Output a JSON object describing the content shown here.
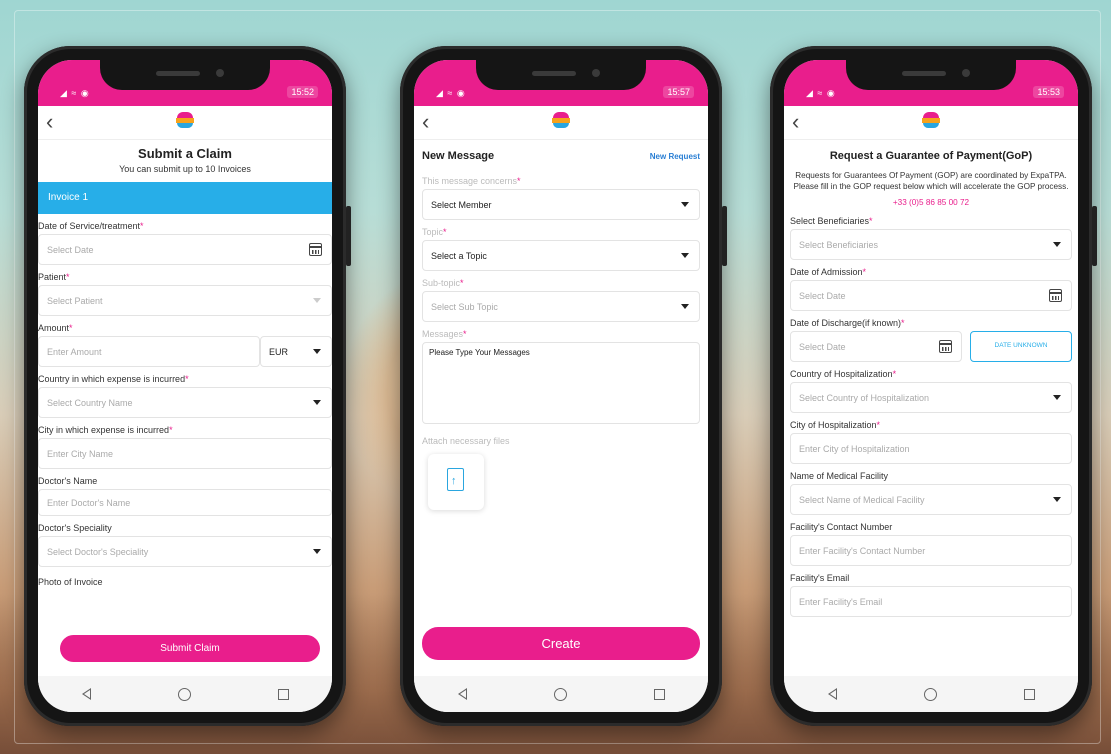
{
  "status": {
    "signal": "◢ ≈ ◉"
  },
  "claim": {
    "time": "15:52",
    "title": "Submit a Claim",
    "subtitle": "You can submit up to 10 Invoices",
    "invoice_label": "Invoice 1",
    "fields": {
      "service_date": {
        "label": "Date of Service/treatment",
        "placeholder": "Select Date"
      },
      "patient": {
        "label": "Patient",
        "placeholder": "Select Patient"
      },
      "amount": {
        "label": "Amount",
        "placeholder": "Enter Amount",
        "currency": "EUR"
      },
      "country": {
        "label": "Country in which expense is incurred",
        "placeholder": "Select Country Name"
      },
      "city": {
        "label": "City in which expense is incurred",
        "placeholder": "Enter City Name"
      },
      "doctor_name": {
        "label": "Doctor's Name",
        "placeholder": "Enter Doctor's Name"
      },
      "doctor_speciality": {
        "label": "Doctor's Speciality",
        "placeholder": "Select Doctor's Speciality"
      },
      "photo": {
        "label": "Photo of Invoice"
      }
    },
    "submit_label": "Submit Claim"
  },
  "message": {
    "time": "15:57",
    "title": "New Message",
    "new_request": "New Request",
    "concerns": {
      "label": "This message concerns",
      "value": "Select Member"
    },
    "topic": {
      "label": "Topic",
      "value": "Select a Topic"
    },
    "subtopic": {
      "label": "Sub-topic",
      "placeholder": "Select Sub Topic"
    },
    "messages": {
      "label": "Messages",
      "placeholder": "Please Type Your Messages"
    },
    "attach_label": "Attach necessary files",
    "create_label": "Create"
  },
  "gop": {
    "time": "15:53",
    "title": "Request a Guarantee of Payment(GoP)",
    "description": "Requests for Guarantees Of Payment (GOP) are coordinated by ExpaTPA. Please fill in the GOP request below which will accelerate the GOP process.",
    "phone": "+33 (0)5 86 85 00 72",
    "beneficiaries": {
      "label": "Select Beneficiaries",
      "placeholder": "Select Beneficiaries"
    },
    "admission": {
      "label": "Date of Admission",
      "placeholder": "Select Date"
    },
    "discharge": {
      "label": "Date of Discharge(if known)",
      "placeholder": "Select Date",
      "unknown_button": "DATE UNKNOWN"
    },
    "country": {
      "label": "Country of Hospitalization",
      "placeholder": "Select Country of Hospitalization"
    },
    "city": {
      "label": "City of Hospitalization",
      "placeholder": "Enter City of Hospitalization"
    },
    "facility": {
      "label": "Name of Medical Facility",
      "placeholder": "Select Name of Medical Facility"
    },
    "contact": {
      "label": "Facility's Contact Number",
      "placeholder": "Enter Facility's Contact Number"
    },
    "email": {
      "label": "Facility's Email",
      "placeholder": "Enter Facility's Email"
    }
  },
  "colors": {
    "accent": "#e91e8c",
    "invoice_bar": "#27aee8",
    "link": "#2a7fd4"
  }
}
